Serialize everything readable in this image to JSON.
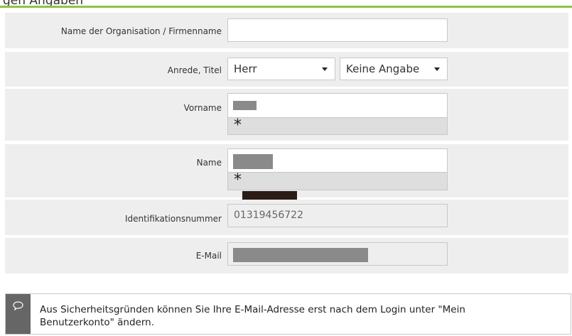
{
  "form": {
    "section_title": "gen Angaben",
    "organisation": {
      "label": "Name der Organisation / Firmenname",
      "value": ""
    },
    "anrede": {
      "label": "Anrede, Titel",
      "salutation": "Herr",
      "title": "Keine Angabe"
    },
    "vorname": {
      "label": "Vorname",
      "required_mark": "*"
    },
    "name": {
      "label": "Name",
      "required_mark": "*"
    },
    "id": {
      "label": "Identifikationsnummer",
      "value": "01319456722"
    },
    "email": {
      "label": "E-Mail"
    }
  },
  "notice": {
    "icon": "speech-bubble-icon",
    "text": "Aus Sicherheitsgründen können Sie Ihre E-Mail-Adresse erst nach dem Login unter \"Mein Benutzerkonto\" ändern."
  },
  "colors": {
    "accent_green": "#8cc63f",
    "row_bg": "#eeeeee",
    "notice_icon_bg": "#666666"
  }
}
